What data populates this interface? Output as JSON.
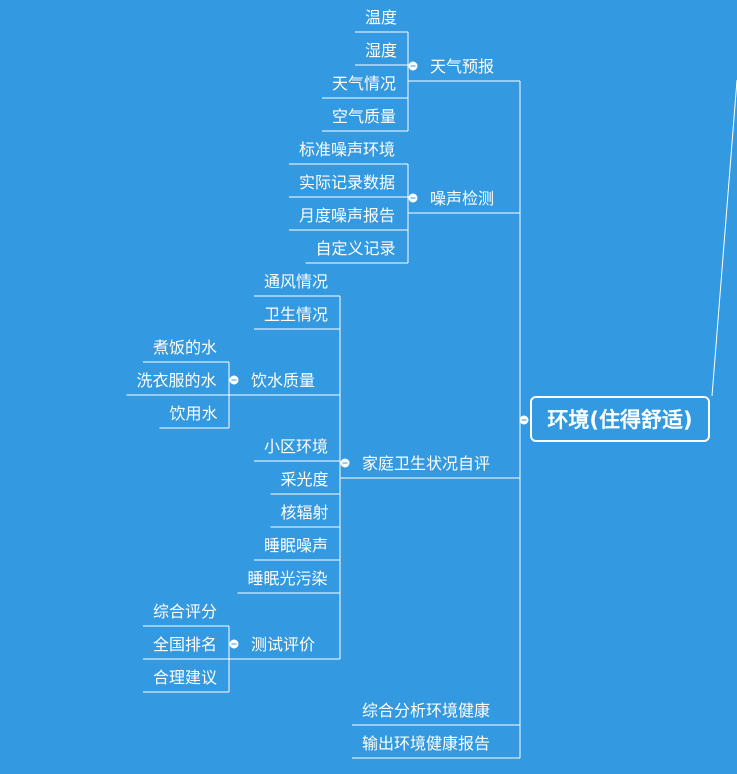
{
  "root": "环境(住得舒适)",
  "branches": [
    {
      "label": "天气预报",
      "children": [
        {
          "label": "温度"
        },
        {
          "label": "湿度"
        },
        {
          "label": "天气情况"
        },
        {
          "label": "空气质量"
        }
      ]
    },
    {
      "label": "噪声检测",
      "children": [
        {
          "label": "标准噪声环境"
        },
        {
          "label": "实际记录数据"
        },
        {
          "label": "月度噪声报告"
        },
        {
          "label": "自定义记录"
        }
      ]
    },
    {
      "label": "家庭卫生状况自评",
      "children": [
        {
          "label": "通风情况"
        },
        {
          "label": "卫生情况"
        },
        {
          "label": "饮水质量",
          "children": [
            {
              "label": "煮饭的水"
            },
            {
              "label": "洗衣服的水"
            },
            {
              "label": "饮用水"
            }
          ]
        },
        {
          "label": "小区环境"
        },
        {
          "label": "采光度"
        },
        {
          "label": "核辐射"
        },
        {
          "label": "睡眠噪声"
        },
        {
          "label": "睡眠光污染"
        },
        {
          "label": "测试评价",
          "children": [
            {
              "label": "综合评分"
            },
            {
              "label": "全国排名"
            },
            {
              "label": "合理建议"
            }
          ]
        }
      ]
    },
    {
      "label": "综合分析环境健康"
    },
    {
      "label": "输出环境健康报告"
    }
  ],
  "colors": {
    "background": "#3399e0",
    "line": "#ffffff",
    "text": "#ffffff"
  }
}
